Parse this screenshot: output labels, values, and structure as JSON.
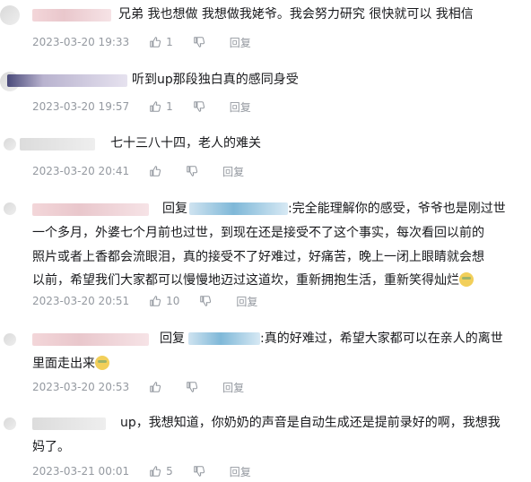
{
  "comments": [
    {
      "text": "兄弟 我也想做 我想做我姥爷。我会努力研究 很快就可以 我相信",
      "time": "2023-03-20 19:33",
      "likes": "1",
      "reply_label": "回复"
    },
    {
      "text": "听到up那段独白真的感同身受",
      "time": "2023-03-20 19:57",
      "likes": "1",
      "reply_label": "回复"
    },
    {
      "text": "七十三八十四，老人的难关",
      "time": "2023-03-20 20:41",
      "likes": "",
      "reply_label": "回复"
    },
    {
      "reply_prefix": "回复",
      "lines": [
        ":完全能理解你的感受，爷爷也是刚过世",
        "一个多月，外婆七个月前也过世，到现在还是接受不了这个事实，每次看回以前的",
        "照片或者上香都会流眼泪，真的接受不了好难过，好痛苦，晚上一闭上眼睛就会想",
        "以前，希望我们大家都可以慢慢地迈过这道坎，重新拥抱生活，重新笑得灿烂"
      ],
      "emoji": "smile-emoji",
      "time": "2023-03-20 20:51",
      "likes": "10",
      "reply_label": "回复"
    },
    {
      "reply_prefix": "回复",
      "lines": [
        ":真的好难过，希望大家都可以在亲人的离世",
        "里面走出来"
      ],
      "emoji": "smile-emoji",
      "time": "2023-03-20 20:53",
      "likes": "",
      "reply_label": "回复"
    },
    {
      "lines": [
        "up，我想知道，你奶奶的声音是自动生成还是提前录好的啊，我想我",
        "妈了。"
      ],
      "time": "2023-03-21 00:01",
      "likes": "5",
      "reply_label": "回复"
    }
  ],
  "icons": {
    "like": "thumbs-up-icon",
    "dislike": "thumbs-down-icon"
  },
  "colors": {
    "text": "#18191c",
    "meta": "#9499a0"
  }
}
